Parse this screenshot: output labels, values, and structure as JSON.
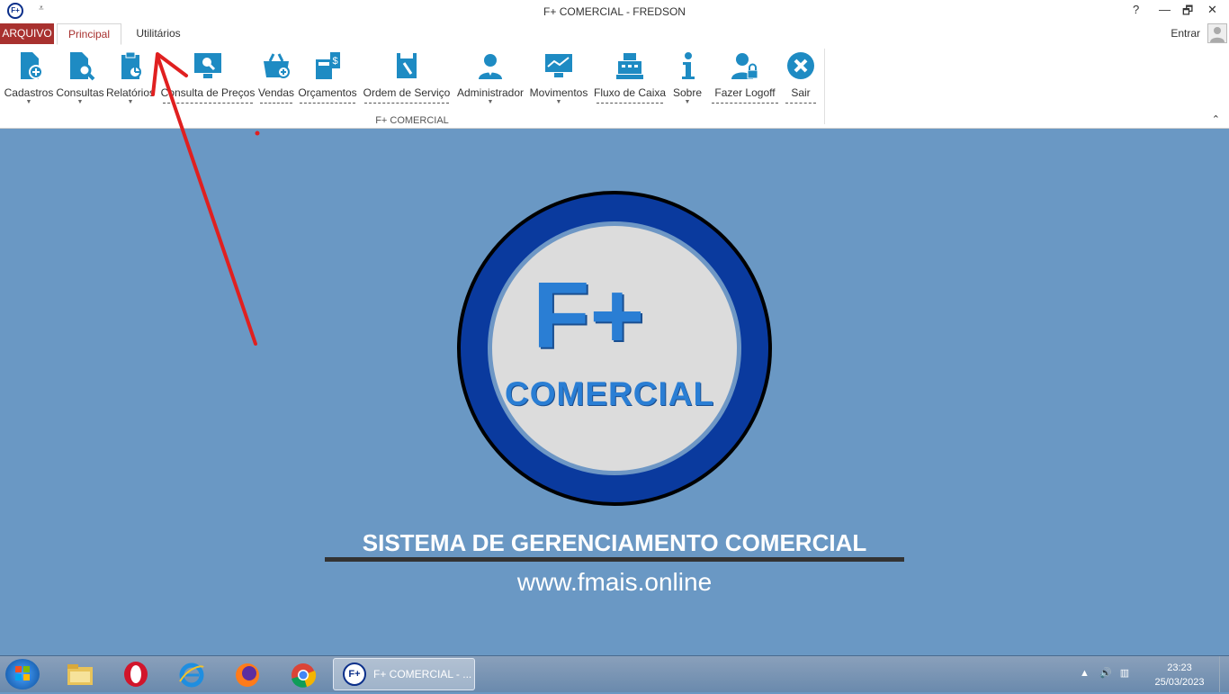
{
  "window": {
    "title": "F+ COMERCIAL - FREDSON",
    "app_icon_text": "F+",
    "qat_symbol": "⩡",
    "help": "?",
    "minimize": "—",
    "restore": "🗗",
    "close": "✕"
  },
  "tabs": {
    "file": "ARQUIVO",
    "principal": "Principal",
    "utilitarios": "Utilitários",
    "login": "Entrar"
  },
  "ribbon": {
    "group_label": "F+ COMERCIAL",
    "collapse_symbol": "⌃",
    "buttons": [
      {
        "label": "Cadastros",
        "icon": "file-add-icon",
        "dropdown": true
      },
      {
        "label": "Consultas",
        "icon": "file-search-icon",
        "dropdown": true
      },
      {
        "label": "Relatórios",
        "icon": "clipboard-chart-icon",
        "dropdown": true
      },
      {
        "label": "Consulta de Preços",
        "icon": "monitor-search-icon",
        "dropdown": false
      },
      {
        "label": "Vendas",
        "icon": "basket-add-icon",
        "dropdown": false
      },
      {
        "label": "Orçamentos",
        "icon": "calculator-money-icon",
        "dropdown": false
      },
      {
        "label": "Ordem de Serviço",
        "icon": "service-order-icon",
        "dropdown": false
      },
      {
        "label": "Administrador",
        "icon": "admin-user-icon",
        "dropdown": true
      },
      {
        "label": "Movimentos",
        "icon": "monitor-chart-icon",
        "dropdown": true
      },
      {
        "label": "Fluxo de Caixa",
        "icon": "cash-register-icon",
        "dropdown": false
      },
      {
        "label": "Sobre",
        "icon": "info-icon",
        "dropdown": true
      },
      {
        "label": "Fazer Logoff",
        "icon": "user-lock-icon",
        "dropdown": false
      },
      {
        "label": "Sair",
        "icon": "close-circle-icon",
        "dropdown": false
      }
    ]
  },
  "main": {
    "logo_big": "F+",
    "logo_word": "COMERCIAL",
    "system_title": "SISTEMA DE GERENCIAMENTO COMERCIAL",
    "url": "www.fmais.online"
  },
  "taskbar": {
    "task_label": "F+ COMERCIAL - ...",
    "task_icon_text": "F+",
    "time": "23:23",
    "date": "25/03/2023",
    "pinned": [
      "file-explorer-icon",
      "opera-icon",
      "internet-explorer-icon",
      "firefox-icon",
      "chrome-icon"
    ]
  },
  "colors": {
    "accent": "#a8312f",
    "ribbon_icon": "#1e8bc3",
    "background": "#6a98c4",
    "annotation": "#e02020"
  }
}
